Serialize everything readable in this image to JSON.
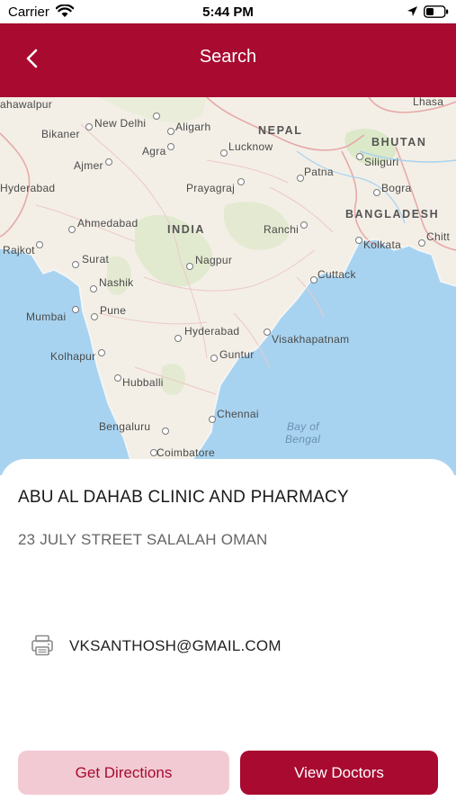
{
  "status_bar": {
    "carrier": "Carrier",
    "time": "5:44 PM"
  },
  "nav": {
    "title": "Search"
  },
  "map": {
    "labels": {
      "bahawalpur": "ahawalpur",
      "lhasa": "Lhasa",
      "new_delhi": "New Delhi",
      "aligarh": "Aligarh",
      "bikaner": "Bikaner",
      "nepal": "NEPAL",
      "agra": "Agra",
      "lucknow": "Lucknow",
      "bhutan": "BHUTAN",
      "ajmer": "Ajmer",
      "siliguri": "Siliguri",
      "patna": "Patna",
      "hyderabad_pk": "Hyderabad",
      "prayagraj": "Prayagraj",
      "bogra": "Bogra",
      "bangladesh": "BANGLADESH",
      "ahmedabad": "Ahmedabad",
      "india": "INDIA",
      "ranchi": "Ranchi",
      "chittagong": "Chitt",
      "rajkot": "Rajkot",
      "kolkata": "Kolkata",
      "surat": "Surat",
      "nagpur": "Nagpur",
      "nashik": "Nashik",
      "cuttack": "Cuttack",
      "mumbai": "Mumbai",
      "pune": "Pune",
      "hyderabad": "Hyderabad",
      "visakhapatnam": "Visakhapatnam",
      "kolhapur": "Kolhapur",
      "guntur": "Guntur",
      "hubballi": "Hubballi",
      "chennai": "Chennai",
      "bay_of": "Bay of",
      "bengal": "Bengal",
      "bengaluru": "Bengaluru",
      "coimbatore": "Coimbatore"
    },
    "colors": {
      "land": "#f3efe6",
      "water": "#a8d3f0",
      "park": "#d9e8c5",
      "border": "#e7a9a9"
    }
  },
  "clinic": {
    "name": "ABU AL DAHAB CLINIC AND PHARMACY",
    "address": "23 JULY STREET SALALAH OMAN",
    "email": "VKSANTHOSH@GMAIL.COM"
  },
  "actions": {
    "directions_label": "Get Directions",
    "doctors_label": "View Doctors"
  },
  "icons": {
    "back": "chevron-left-icon",
    "fax": "fax-icon",
    "wifi": "wifi-icon",
    "location": "location-arrow-icon",
    "battery": "battery-icon"
  },
  "colors": {
    "accent": "#a80a30",
    "accent_light": "#f2cad3"
  }
}
